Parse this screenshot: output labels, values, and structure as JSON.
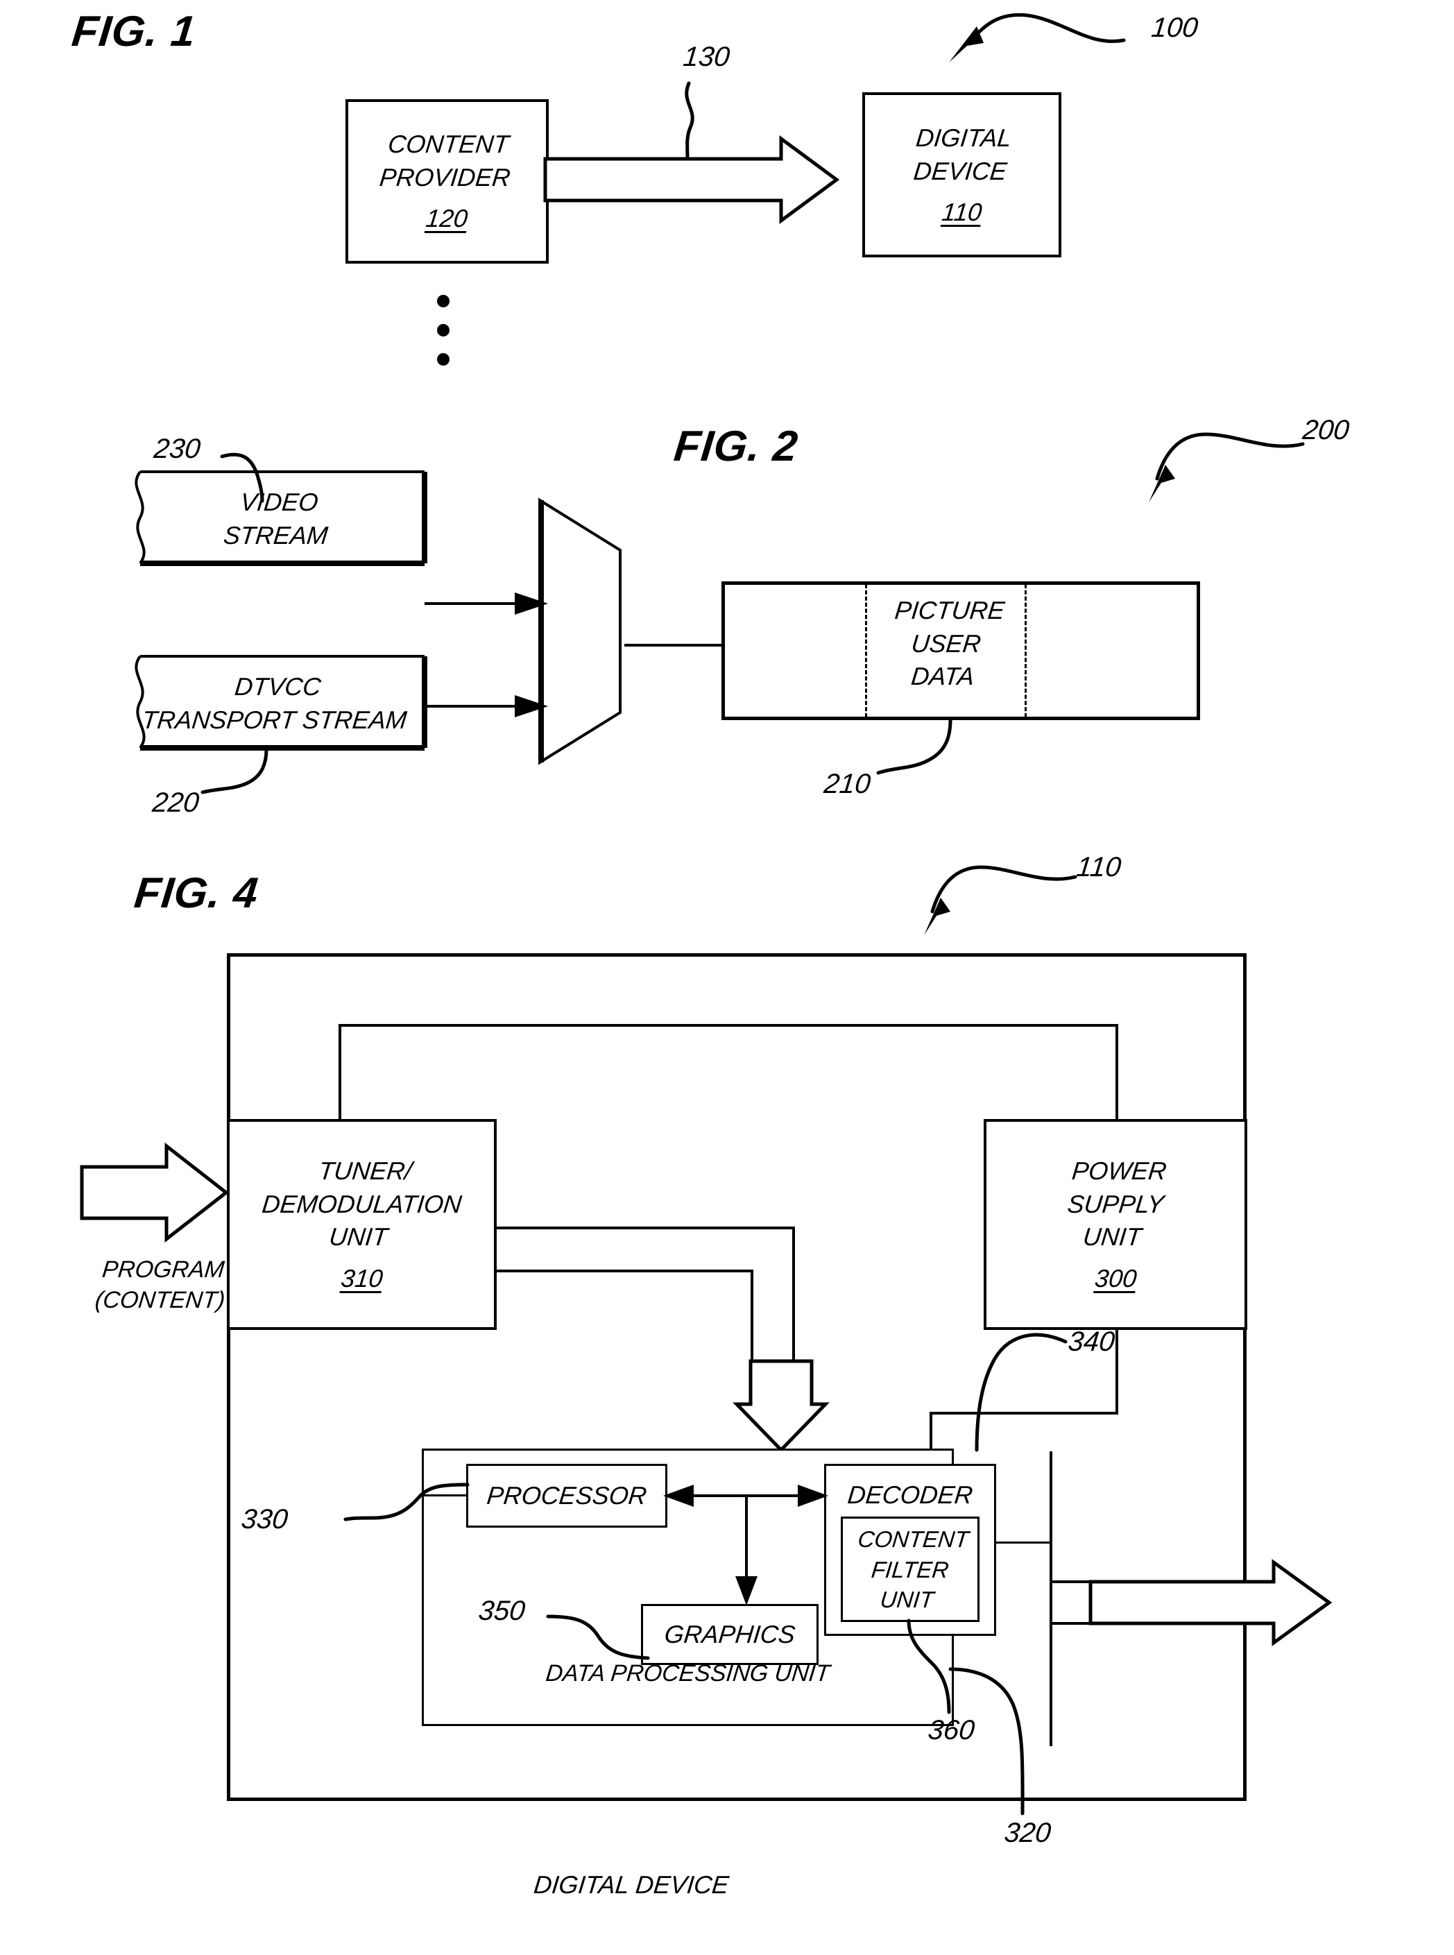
{
  "figures": {
    "fig1": {
      "title": "FIG. 1",
      "system_ref": "100",
      "link_ref": "130",
      "boxes": {
        "content_provider": {
          "label": "CONTENT\nPROVIDER",
          "ref": "120"
        },
        "digital_device": {
          "label": "DIGITAL\nDEVICE",
          "ref": "110"
        }
      }
    },
    "fig2": {
      "title": "FIG. 2",
      "system_ref": "200",
      "boxes": {
        "video_stream": {
          "label": "VIDEO\nSTREAM",
          "ref": "230"
        },
        "dtvcc_stream": {
          "label": "DTVCC\nTRANSPORT STREAM",
          "ref": "220"
        },
        "picture_user_data": {
          "label": "PICTURE\nUSER\nDATA",
          "ref": "210"
        }
      },
      "mux_name": "multiplexer"
    },
    "fig4": {
      "title": "FIG. 4",
      "system_ref": "110",
      "input_label": "PROGRAM\n(CONTENT)",
      "outer_label": "DIGITAL DEVICE",
      "boxes": {
        "tuner": {
          "label": "TUNER/\nDEMODULATION\nUNIT",
          "ref": "310"
        },
        "power_supply": {
          "label": "POWER\nSUPPLY\nUNIT",
          "ref": "300"
        },
        "data_processing_unit": {
          "label": "DATA PROCESSING UNIT",
          "ref": "320"
        },
        "processor": {
          "label": "PROCESSOR",
          "ref": "330"
        },
        "decoder": {
          "label": "DECODER",
          "ref": "340"
        },
        "content_filter_unit": {
          "label": "CONTENT\nFILTER UNIT",
          "ref": "360"
        },
        "graphics": {
          "label": "GRAPHICS",
          "ref": "350"
        }
      }
    }
  },
  "ellipsis": {
    "name": "vertical-ellipsis",
    "dots": 3
  },
  "colors": {
    "ink": "#000000",
    "paper": "#ffffff"
  }
}
